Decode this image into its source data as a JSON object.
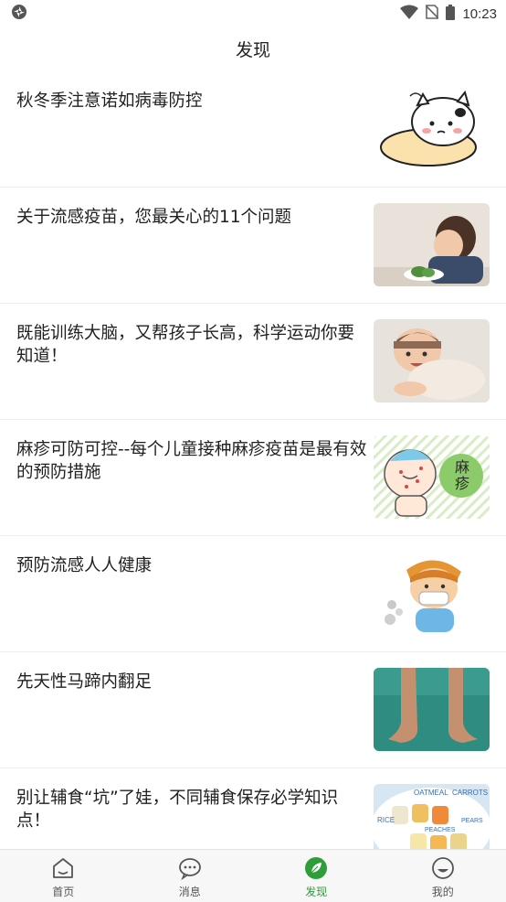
{
  "status_bar": {
    "time": "10:23"
  },
  "header": {
    "title": "发现"
  },
  "articles": [
    {
      "title": "秋冬季注意诺如病毒防控",
      "thumb_icon": "cartoon-sick-cat-image"
    },
    {
      "title": "关于流感疫苗，您最关心的11个问题",
      "thumb_icon": "crying-child-photo"
    },
    {
      "title": "既能训练大脑，又帮孩子长高，科学运动你要知道！",
      "thumb_icon": "crawling-baby-photo"
    },
    {
      "title": "麻疹可防可控--每个儿童接种麻疹疫苗是最有效的预防措施",
      "thumb_icon": "measles-cartoon-image",
      "thumb_text": "麻疹"
    },
    {
      "title": "预防流感人人健康",
      "thumb_icon": "masked-boy-cartoon-image"
    },
    {
      "title": "先天性马蹄内翻足",
      "thumb_icon": "clubfoot-photo"
    },
    {
      "title": "别让辅食“坑”了娃，不同辅食保存必学知识点！",
      "thumb_icon": "baby-food-cubes-photo",
      "thumb_labels": [
        "OATMEAL",
        "CARROTS",
        "RICE",
        "PEACHES",
        "PEARS"
      ]
    }
  ],
  "tabbar": {
    "active": "discover",
    "items": [
      {
        "id": "home",
        "label": "首页"
      },
      {
        "id": "messages",
        "label": "消息"
      },
      {
        "id": "discover",
        "label": "发现"
      },
      {
        "id": "mine",
        "label": "我的"
      }
    ]
  },
  "colors": {
    "accent": "#2e9d3a",
    "tabbar_bg": "#f7f7f7",
    "text": "#1f1f1f",
    "divider": "#eeeeee"
  }
}
